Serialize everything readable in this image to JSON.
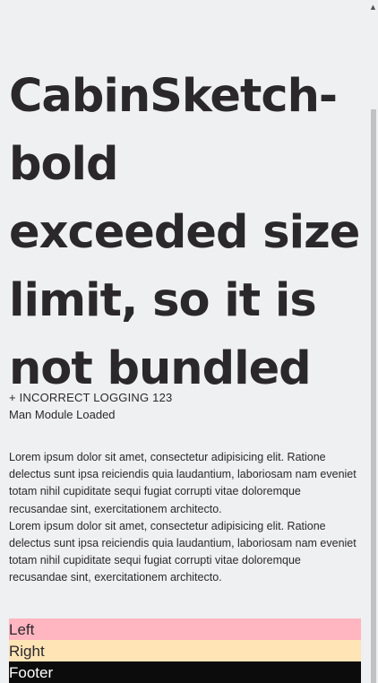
{
  "hero": {
    "title": "CabinSketch-bold exceeded size limit, so it is not bundled"
  },
  "log": {
    "title": "+ INCORRECT LOGGING 123",
    "status": "Man Module Loaded"
  },
  "lorem": {
    "paragraphs": [
      "Lorem ipsum dolor sit amet, consectetur adipisicing elit. Ratione delectus sunt ipsa reiciendis quia laudantium, laboriosam nam eveniet totam nihil cupiditate sequi fugiat corrupti vitae doloremque recusandae sint, exercitationem architecto.",
      "Lorem ipsum dolor sit amet, consectetur adipisicing elit. Ratione delectus sunt ipsa reiciendis quia laudantium, laboriosam nam eveniet totam nihil cupiditate sequi fugiat corrupti vitae doloremque recusandae sint, exercitationem architecto."
    ]
  },
  "bars": {
    "left": "Left",
    "right": "Right",
    "footer": "Footer"
  },
  "colors": {
    "background": "#eff0f2",
    "left_bar": "#ffb6c1",
    "right_bar": "#ffe4b5",
    "footer_bar": "#0c0c0c"
  },
  "icons": {
    "scroll_up": "scroll-up-arrow-icon"
  }
}
